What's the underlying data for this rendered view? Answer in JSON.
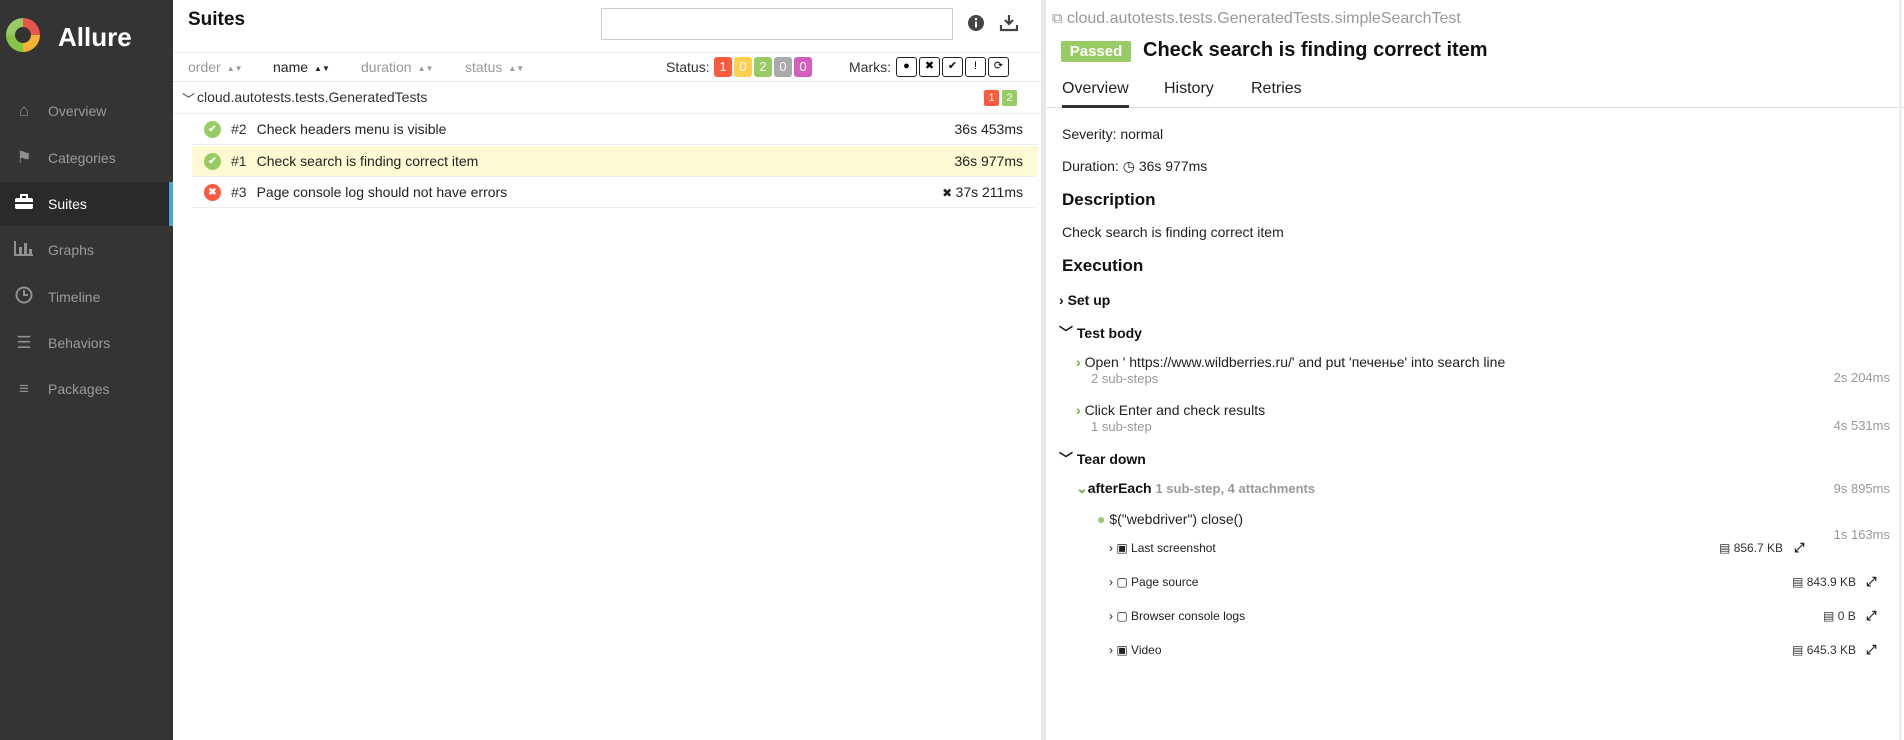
{
  "sidebar": {
    "brand": "Allure",
    "items": [
      {
        "label": "Overview",
        "icon": "home-icon"
      },
      {
        "label": "Categories",
        "icon": "flag-icon"
      },
      {
        "label": "Suites",
        "icon": "briefcase-icon",
        "active": true
      },
      {
        "label": "Graphs",
        "icon": "bar-chart-icon"
      },
      {
        "label": "Timeline",
        "icon": "clock-icon"
      },
      {
        "label": "Behaviors",
        "icon": "list-icon"
      },
      {
        "label": "Packages",
        "icon": "align-left-icon"
      }
    ]
  },
  "suites": {
    "title": "Suites",
    "search_value": "",
    "sort": {
      "order": "order",
      "name": "name",
      "duration": "duration",
      "status": "status"
    },
    "status_label": "Status:",
    "status_counts": [
      "1",
      "0",
      "2",
      "0",
      "0"
    ],
    "marks_label": "Marks:",
    "group": {
      "name": "cloud.autotests.tests.GeneratedTests",
      "failed": "1",
      "passed": "2"
    },
    "tests": [
      {
        "num": "#2",
        "name": "Check headers menu is visible",
        "duration": "36s 453ms",
        "status": "passed"
      },
      {
        "num": "#1",
        "name": "Check search is finding correct item",
        "duration": "36s 977ms",
        "status": "passed",
        "selected": true
      },
      {
        "num": "#3",
        "name": "Page console log should not have errors",
        "duration": "37s 211ms",
        "status": "failed"
      }
    ]
  },
  "details": {
    "path": "cloud.autotests.tests.GeneratedTests.simpleSearchTest",
    "status": "Passed",
    "title": "Check search is finding correct item",
    "tabs": [
      "Overview",
      "History",
      "Retries"
    ],
    "severity": "Severity: normal",
    "duration_label": "Duration:",
    "duration": "36s 977ms",
    "description_heading": "Description",
    "description": "Check search is finding correct item",
    "execution_heading": "Execution",
    "setup": "Set up",
    "test_body": "Test body",
    "steps": [
      {
        "name": "Open ' https://www.wildberries.ru/' and put 'печенье' into search line",
        "sub": "2 sub-steps",
        "time": "2s 204ms"
      },
      {
        "name": "Click Enter and check results",
        "sub": "1 sub-step",
        "time": "4s 531ms"
      }
    ],
    "teardown": "Tear down",
    "after_each": {
      "name": "afterEach",
      "sub": "1 sub-step, 4 attachments",
      "time": "9s 895ms"
    },
    "webdriver": {
      "name": "$(\"webdriver\") close()",
      "time": "1s 163ms"
    },
    "attachments": [
      {
        "name": "Last screenshot",
        "size": "856.7 KB"
      },
      {
        "name": "Page source",
        "size": "843.9 KB"
      },
      {
        "name": "Browser console logs",
        "size": "0 B"
      },
      {
        "name": "Video",
        "size": "645.3 KB"
      }
    ]
  }
}
